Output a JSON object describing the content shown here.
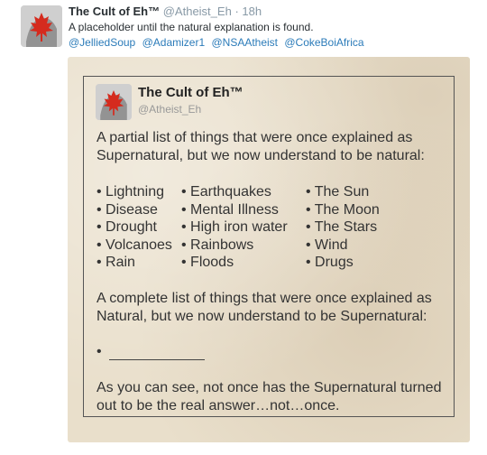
{
  "tweet": {
    "display_name": "The Cult of Eh™",
    "handle": "@Atheist_Eh",
    "separator": "·",
    "time": "18h",
    "text": "A placeholder until the natural explanation is found.",
    "mentions": [
      "@JelliedSoup",
      "@Adamizer1",
      "@NSAAtheist",
      "@CokeBoiAfrica"
    ]
  },
  "card": {
    "display_name": "The Cult of Eh™",
    "handle": "@Atheist_Eh",
    "intro": "A partial list of things that were once explained as Supernatural, but we now understand to be natural:",
    "columns": [
      [
        "• Lightning",
        "• Disease",
        "• Drought",
        "• Volcanoes",
        "• Rain"
      ],
      [
        "• Earthquakes",
        "• Mental Illness",
        "• High iron water",
        "• Rainbows",
        "• Floods"
      ],
      [
        "• The Sun",
        "• The Moon",
        "• The Stars",
        "• Wind",
        "• Drugs"
      ]
    ],
    "complete": "A complete list of things that were once explained as Natural, but we now understand to be Supernatural:",
    "blank_bullet": "•",
    "outro": "As you can see, not once has the Supernatural turned out to be the real answer…not…once."
  },
  "colors": {
    "link": "#2b7bb9",
    "muted": "#8899a6",
    "leaf": "#d52b1e",
    "paper": "#e9dfcb"
  },
  "icons": {
    "avatar": "maple-leaf-avatar-icon"
  }
}
